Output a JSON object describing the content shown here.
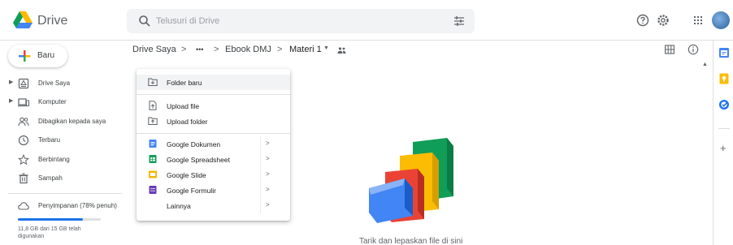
{
  "header": {
    "app_name": "Drive",
    "search_placeholder": "Telusuri di Drive"
  },
  "sidebar": {
    "new_label": "Baru",
    "items": [
      {
        "label": "Drive Saya",
        "icon": "my-drive-icon",
        "expandable": true
      },
      {
        "label": "Komputer",
        "icon": "computer-icon",
        "expandable": true
      },
      {
        "label": "Dibagikan kepada saya",
        "icon": "shared-icon",
        "expandable": false
      },
      {
        "label": "Terbaru",
        "icon": "clock-icon",
        "expandable": false
      },
      {
        "label": "Berbintang",
        "icon": "star-icon",
        "expandable": false
      },
      {
        "label": "Sampah",
        "icon": "trash-icon",
        "expandable": false
      }
    ],
    "storage": {
      "label": "Penyimpanan (78% penuh)",
      "fraction": 0.78,
      "detail": "11,8 GB dari 15 GB telah digunakan"
    }
  },
  "breadcrumb": {
    "root": "Drive Saya",
    "more": "•••",
    "folder1": "Ebook DMJ",
    "current": "Materi 1",
    "separator": ">"
  },
  "menu": {
    "items": [
      {
        "label": "Folder baru",
        "icon": "new-folder-icon"
      },
      {
        "label": "Upload file",
        "icon": "file-upload-icon"
      },
      {
        "label": "Upload folder",
        "icon": "folder-upload-icon"
      },
      {
        "label": "Google Dokumen",
        "icon": "google-docs-icon",
        "color": "#4285f4",
        "submenu": true
      },
      {
        "label": "Google Spreadsheet",
        "icon": "google-sheets-icon",
        "color": "#0f9d58",
        "submenu": true
      },
      {
        "label": "Google Slide",
        "icon": "google-slides-icon",
        "color": "#f4b400",
        "submenu": true
      },
      {
        "label": "Google Formulir",
        "icon": "google-forms-icon",
        "color": "#673ab7",
        "submenu": true
      },
      {
        "label": "Lainnya",
        "icon": "",
        "submenu": true
      }
    ],
    "submenu_arrow": ">"
  },
  "empty_state": {
    "text": "Tarik dan lepaskan file di sini"
  },
  "colors": {
    "accent": "#1a73e8",
    "drive_green": "#0f9d58",
    "drive_yellow": "#f4b400",
    "drive_red": "#db4437",
    "drive_blue": "#4285f4"
  }
}
